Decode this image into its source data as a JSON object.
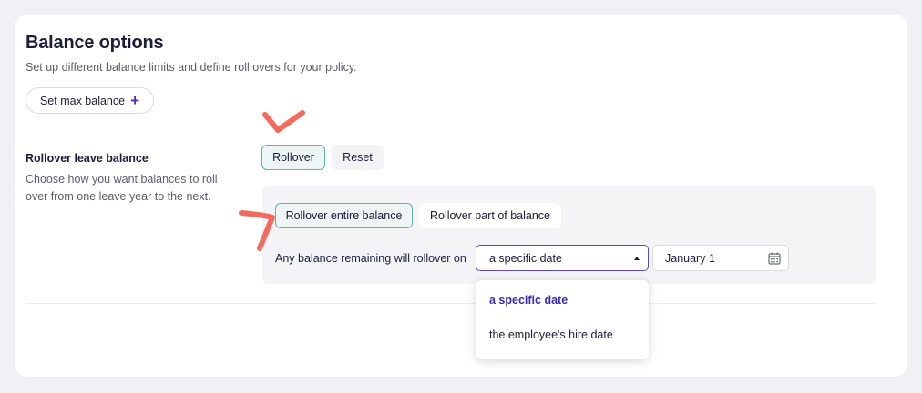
{
  "balance_options": {
    "title": "Balance options",
    "subtitle": "Set up different balance limits and define roll overs for your policy.",
    "set_max_balance_label": "Set max balance",
    "set_max_balance_icon": "+"
  },
  "rollover_section": {
    "label": "Rollover leave balance",
    "description": "Choose how you want balances to roll over from one leave year to the next.",
    "mode_tabs": [
      {
        "label": "Rollover",
        "selected": true
      },
      {
        "label": "Reset",
        "selected": false
      }
    ],
    "amount_tabs": [
      {
        "label": "Rollover entire balance",
        "selected": true
      },
      {
        "label": "Rollover part of balance",
        "selected": false
      }
    ],
    "rollover_on_label": "Any balance remaining will rollover on",
    "date_type_select": {
      "value": "a specific date",
      "options": [
        "a specific date",
        "the employee's hire date"
      ]
    },
    "date_input": {
      "value": "January 1",
      "icon": "calendar-icon"
    }
  },
  "colors": {
    "accent": "#4a32c8",
    "selected_border": "#5fb3b0",
    "annotation": "#f26b5e",
    "heading": "#1e1c3a"
  }
}
